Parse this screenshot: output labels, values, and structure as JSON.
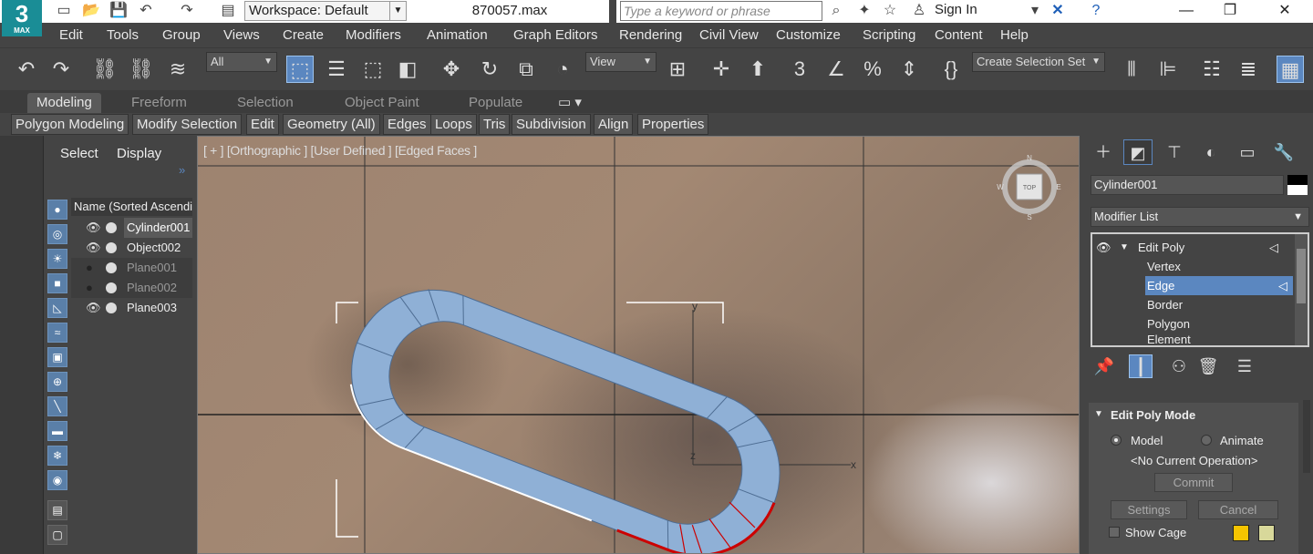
{
  "app": {
    "logo_text": "3",
    "logo_sub": "MAX"
  },
  "titlebar": {
    "workspace_label": "Workspace: Default",
    "filename": "870057.max",
    "search_placeholder": "Type a keyword or phrase",
    "signin_label": "Sign In"
  },
  "menu": [
    "Edit",
    "Tools",
    "Group",
    "Views",
    "Create",
    "Modifiers",
    "Animation",
    "Graph Editors",
    "Rendering",
    "Civil View",
    "Customize",
    "Scripting",
    "Content",
    "Help"
  ],
  "toolbar": {
    "filter_value": "All",
    "refcoord_value": "View",
    "selection_set_placeholder": "Create Selection Set"
  },
  "ribbon": {
    "tabs": [
      "Modeling",
      "Freeform",
      "Selection",
      "Object Paint",
      "Populate"
    ],
    "active_tab": "Modeling",
    "subtabs": [
      "Polygon Modeling",
      "Modify Selection",
      "Edit",
      "Geometry (All)",
      "Edges",
      "Loops",
      "Tris",
      "Subdivision",
      "Align",
      "Properties"
    ]
  },
  "explorer": {
    "tabs": [
      "Select",
      "Display"
    ],
    "column_header": "Name (Sorted Ascending)",
    "rows": [
      {
        "name": "Cylinder001",
        "visible": true,
        "selected": true
      },
      {
        "name": "Object002",
        "visible": true,
        "selected": false
      },
      {
        "name": "Plane001",
        "visible": false,
        "selected": false
      },
      {
        "name": "Plane002",
        "visible": false,
        "selected": false
      },
      {
        "name": "Plane003",
        "visible": true,
        "selected": false
      }
    ]
  },
  "viewport": {
    "label": "[ + ] [Orthographic ] [User Defined ] [Edged Faces ]",
    "viewcube_label": "TOP",
    "compass": {
      "n": "N",
      "s": "S",
      "e": "E",
      "w": "W"
    },
    "gizmo": {
      "x": "x",
      "y": "y",
      "z": "z"
    }
  },
  "command_panel": {
    "object_name": "Cylinder001",
    "modifier_list_label": "Modifier List",
    "stack": [
      {
        "label": "Edit Poly",
        "level": 0
      },
      {
        "label": "Vertex",
        "level": 1
      },
      {
        "label": "Edge",
        "level": 1,
        "active": true
      },
      {
        "label": "Border",
        "level": 1
      },
      {
        "label": "Polygon",
        "level": 1
      },
      {
        "label": "Element",
        "level": 1
      }
    ],
    "rollout": {
      "title": "Edit Poly Mode",
      "model_label": "Model",
      "animate_label": "Animate",
      "current_op": "<No Current Operation>",
      "commit_label": "Commit",
      "settings_label": "Settings",
      "cancel_label": "Cancel",
      "show_cage_label": "Show Cage",
      "cage_colors": [
        "#f5c400",
        "#d8d89a"
      ]
    }
  },
  "colors": {
    "accent_blue": "#5b87c0",
    "mesh_fill": "#8fb0d6",
    "edge_selected": "#cc0000"
  }
}
